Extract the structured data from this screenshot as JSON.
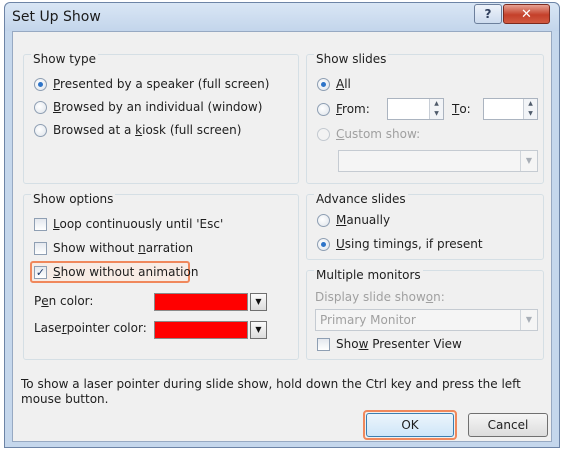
{
  "window": {
    "title": "Set Up Show",
    "help_label": "?",
    "close_label": "✕"
  },
  "show_type": {
    "title": "Show type",
    "options": [
      {
        "pre": "",
        "key": "P",
        "post": "resented by a speaker (full screen)",
        "selected": true
      },
      {
        "pre": "",
        "key": "B",
        "post": "rowsed by an individual (window)",
        "selected": false
      },
      {
        "pre": "Browsed at a ",
        "key": "k",
        "post": "iosk (full screen)",
        "selected": false
      }
    ]
  },
  "show_slides": {
    "title": "Show slides",
    "all": {
      "pre": "",
      "key": "A",
      "post": "ll",
      "selected": true
    },
    "from": {
      "pre": "",
      "key": "F",
      "post": "rom:",
      "selected": false,
      "value": ""
    },
    "to": {
      "pre": "",
      "key": "T",
      "post": "o:",
      "value": ""
    },
    "custom": {
      "pre": "",
      "key": "C",
      "post": "ustom show:",
      "selected": false
    },
    "custom_value": ""
  },
  "show_options": {
    "title": "Show options",
    "checks": [
      {
        "pre": "",
        "key": "L",
        "post": "oop continuously until 'Esc'",
        "checked": false
      },
      {
        "pre": "Show without ",
        "key": "n",
        "post": "arration",
        "checked": false
      },
      {
        "pre": "",
        "key": "S",
        "post": "how without animation",
        "checked": true
      }
    ],
    "pen_color": {
      "pre": "P",
      "key": "e",
      "post": "n color:",
      "color": "#ff0000"
    },
    "laser_color": {
      "pre": "Lase",
      "key": "r",
      "post": " pointer color:",
      "color": "#ff0000"
    }
  },
  "advance": {
    "title": "Advance slides",
    "manually": {
      "pre": "",
      "key": "M",
      "post": "anually",
      "selected": false
    },
    "timings": {
      "pre": "",
      "key": "U",
      "post": "sing timings, if present",
      "selected": true
    }
  },
  "monitors": {
    "title": "Multiple monitors",
    "display_label": {
      "pre": "Display slide show ",
      "key": "o",
      "post": "n:"
    },
    "display_value": "Primary Monitor",
    "presenter": {
      "pre": "Sho",
      "key": "w",
      "post": " Presenter View",
      "checked": false
    }
  },
  "info_text": "To show a laser pointer during slide show, hold down the Ctrl key and press the left mouse button.",
  "buttons": {
    "ok": "OK",
    "cancel": "Cancel"
  },
  "colors": {
    "highlight": "#f0885c",
    "radio_dot": "#2e74c8",
    "swatch": "#ff0000"
  }
}
